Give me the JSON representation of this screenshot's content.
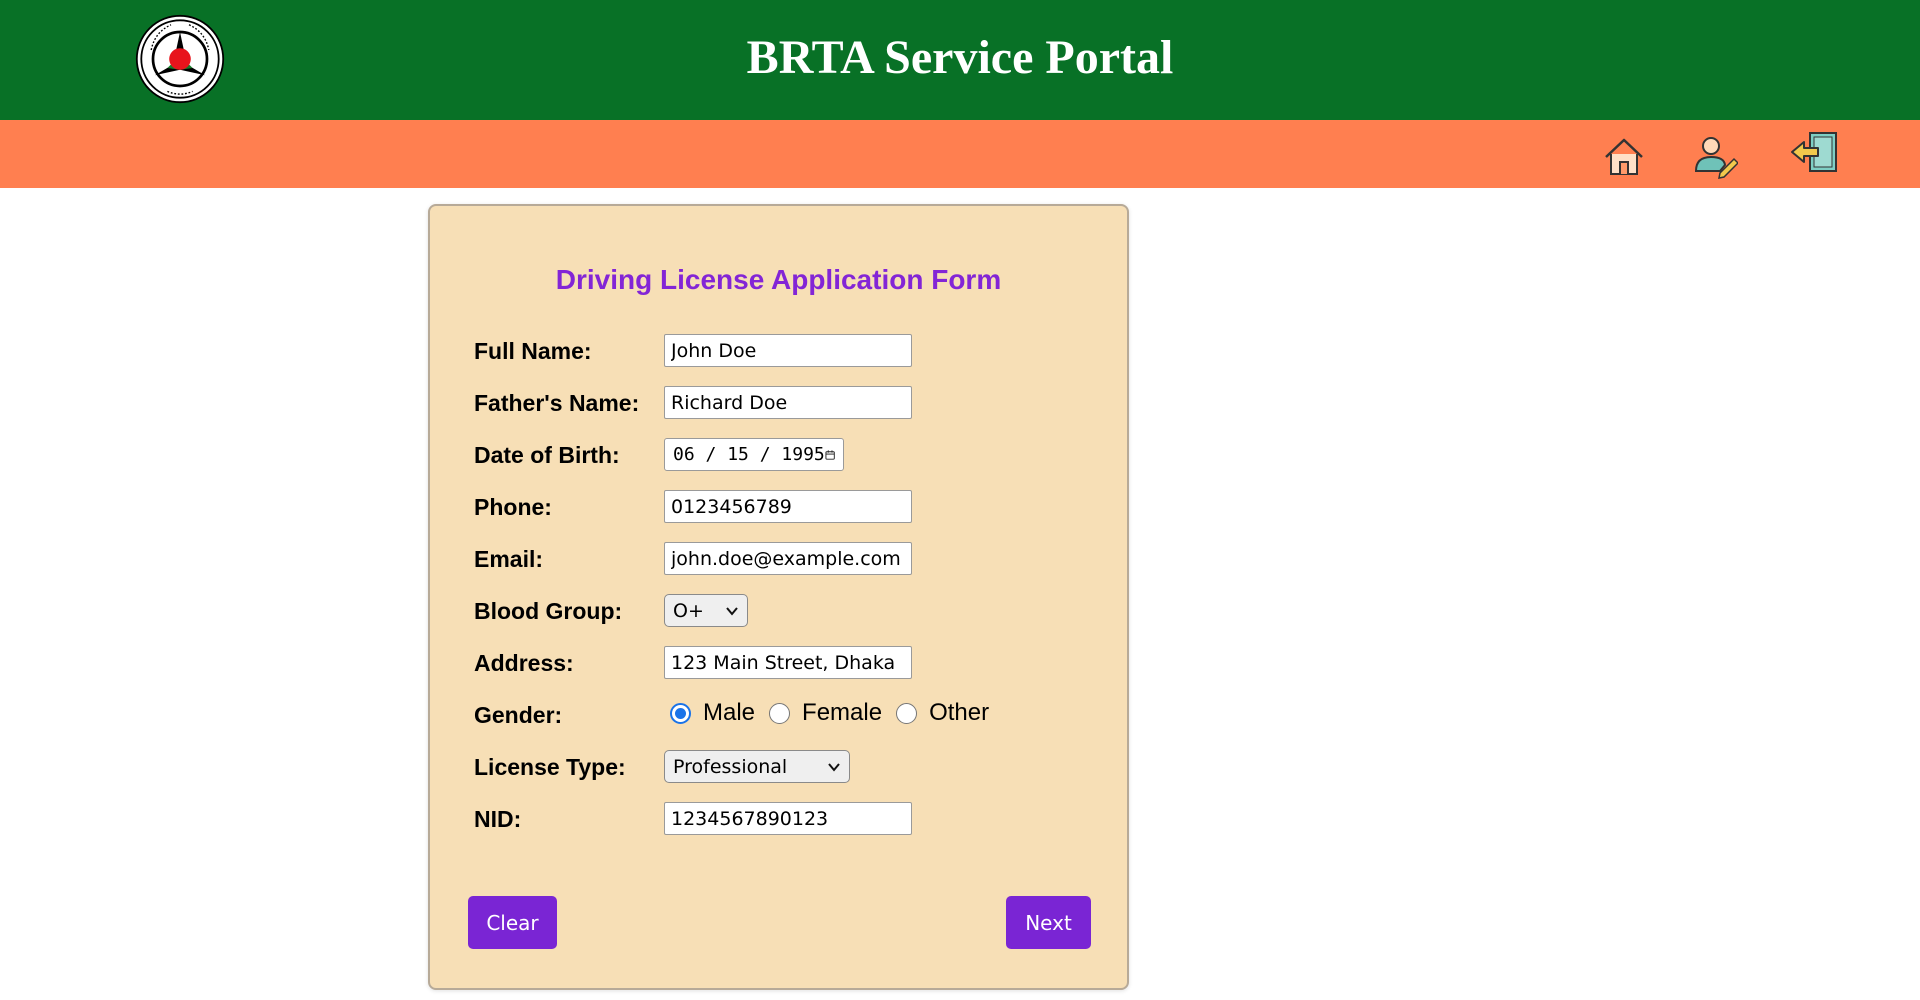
{
  "header": {
    "title": "BRTA Service Portal",
    "bg_color": "#087126",
    "logo_icon": "brta-logo-icon"
  },
  "navbar": {
    "bg_color": "#ff7f50",
    "icons": [
      "home-icon",
      "profile-edit-icon",
      "logout-icon"
    ]
  },
  "form": {
    "title": "Driving License Application Form",
    "title_color": "#8325d6",
    "card_color": "#f7dfb6",
    "labels": {
      "full_name": "Full Name:",
      "father_name": "Father's Name:",
      "dob": "Date of Birth:",
      "phone": "Phone:",
      "email": "Email:",
      "blood_group": "Blood Group:",
      "address": "Address:",
      "gender": "Gender:",
      "license_type": "License Type:",
      "nid": "NID:"
    },
    "values": {
      "full_name": "John Doe",
      "father_name": "Richard Doe",
      "dob_month": "06",
      "dob_day": "15",
      "dob_year": "1995",
      "phone": "0123456789",
      "email": "john.doe@example.com",
      "blood_group": "O+",
      "address": "123 Main Street, Dhaka",
      "gender": "Male",
      "license_type": "Professional",
      "nid": "1234567890123"
    },
    "gender_options": [
      "Male",
      "Female",
      "Other"
    ],
    "buttons": {
      "clear": "Clear",
      "next": "Next",
      "color": "#7a25d4"
    }
  }
}
